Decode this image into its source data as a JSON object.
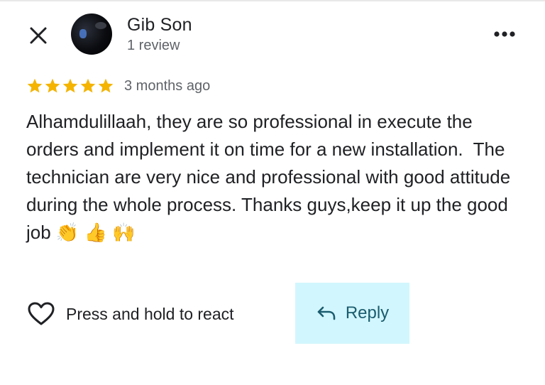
{
  "header": {
    "reviewer_name": "Gib Son",
    "review_count": "1 review"
  },
  "icons": {
    "close": "close-icon",
    "more": "more-vert-icon",
    "star": "star-icon",
    "heart": "heart-outline-icon",
    "reply": "reply-arrow-icon"
  },
  "review": {
    "rating": 5,
    "rating_max": 5,
    "date": "3 months ago",
    "text": "Alhamdulillaah, they are so professional in execute the orders and implement it on time for a new installation.  The technician are very nice and professional with good attitude during the whole process. Thanks guys,keep it up the good job 👏 👍 🙌"
  },
  "actions": {
    "react_label": "Press and hold to react",
    "reply_label": "Reply"
  },
  "colors": {
    "star": "#f4b400",
    "reply_background": "#d2f6fd",
    "reply_text": "#1a5c6e",
    "secondary_text": "#5f6368"
  }
}
